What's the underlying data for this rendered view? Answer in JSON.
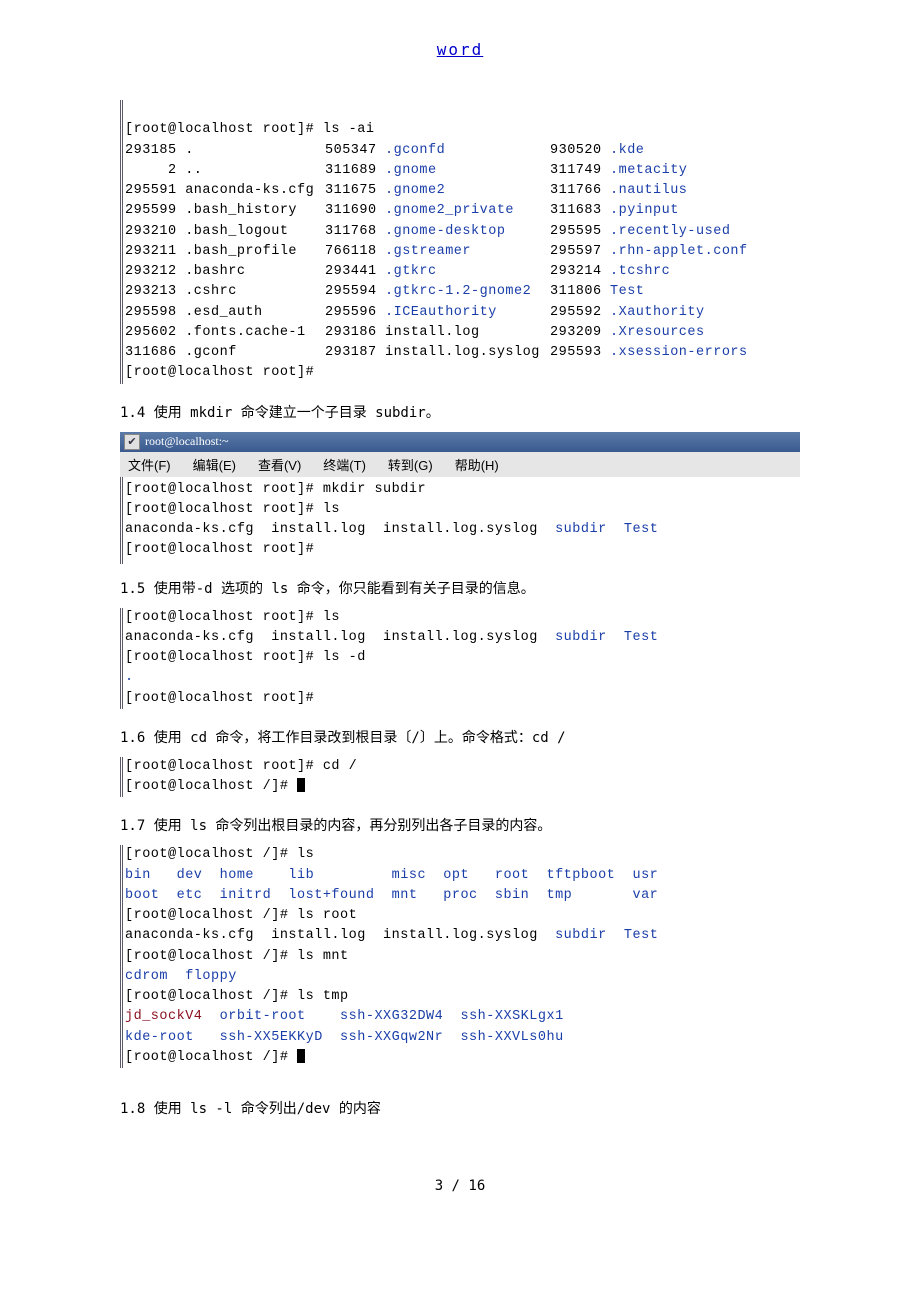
{
  "header": {
    "word_link": "word"
  },
  "ls_ai": {
    "prompt1": "[root@localhost root]# ls -ai",
    "col1": [
      "293185 .",
      "     2 ..",
      "295591 anaconda-ks.cfg",
      "295599 .bash_history",
      "293210 .bash_logout",
      "293211 .bash_profile",
      "293212 .bashrc",
      "293213 .cshrc",
      "295598 .esd_auth",
      "295602 .fonts.cache-1",
      "311686 .gconf"
    ],
    "col2_inode": [
      "505347",
      "311689",
      "311675",
      "311690",
      "311768",
      "766118",
      "293441",
      "295594",
      "295596",
      "293186",
      "293187"
    ],
    "col2_name": [
      ".gconfd",
      ".gnome",
      ".gnome2",
      ".gnome2_private",
      ".gnome-desktop",
      ".gstreamer",
      ".gtkrc",
      ".gtkrc-1.2-gnome2",
      ".ICEauthority",
      "install.log",
      "install.log.syslog"
    ],
    "col3_inode": [
      "930520",
      "311749",
      "311766",
      "311683",
      "295595",
      "295597",
      "293214",
      "311806",
      "295592",
      "293209",
      "295593"
    ],
    "col3_name": [
      ".kde",
      ".metacity",
      ".nautilus",
      ".pyinput",
      ".recently-used",
      ".rhn-applet.conf",
      ".tcshrc",
      "Test",
      ".Xauthority",
      ".Xresources",
      ".xsession-errors"
    ],
    "prompt2": "[root@localhost root]#"
  },
  "sec14": {
    "title": "1.4 使用 mkdir 命令建立一个子目录 subdir。",
    "window_title": "root@localhost:~",
    "menu": {
      "file": "文件(F)",
      "edit": "编辑(E)",
      "view": "查看(V)",
      "term": "终端(T)",
      "go": "转到(G)",
      "help": "帮助(H)"
    },
    "lines": [
      {
        "t": "[root@localhost root]# mkdir subdir"
      },
      {
        "t": "[root@localhost root]# ls"
      },
      {
        "parts": [
          {
            "t": "anaconda-ks.cfg  install.log  install.log.syslog  "
          },
          {
            "t": "subdir  Test",
            "cls": "blue"
          }
        ]
      },
      {
        "t": "[root@localhost root]#"
      }
    ]
  },
  "sec15": {
    "title": "1.5 使用带-d 选项的 ls 命令，你只能看到有关子目录的信息。",
    "lines": [
      {
        "t": "[root@localhost root]# ls"
      },
      {
        "parts": [
          {
            "t": "anaconda-ks.cfg  install.log  install.log.syslog  "
          },
          {
            "t": "subdir  Test",
            "cls": "blue"
          }
        ]
      },
      {
        "t": "[root@localhost root]# ls -d"
      },
      {
        "t": ".",
        "cls": "blue"
      },
      {
        "t": "[root@localhost root]#"
      }
    ]
  },
  "sec16": {
    "title": "1.6 使用 cd 命令，将工作目录改到根目录〔/〕上。命令格式：cd  /",
    "lines": [
      {
        "t": "[root@localhost root]# cd /"
      },
      {
        "t": "[root@localhost /]# ",
        "cursor": true
      }
    ]
  },
  "sec17": {
    "title": "1.7 使用 ls 命令列出根目录的内容，再分别列出各子目录的内容。",
    "lines": [
      {
        "t": "[root@localhost /]# ls"
      },
      {
        "parts": [
          {
            "t": "bin   dev  home    lib         misc  opt   root  tftpboot  usr",
            "cls": "blue"
          }
        ]
      },
      {
        "parts": [
          {
            "t": "boot  etc  initrd  lost+found  mnt   proc  sbin  tmp       var",
            "cls": "blue"
          }
        ]
      },
      {
        "t": "[root@localhost /]# ls root"
      },
      {
        "parts": [
          {
            "t": "anaconda-ks.cfg  install.log  install.log.syslog  "
          },
          {
            "t": "subdir  Test",
            "cls": "blue"
          }
        ]
      },
      {
        "t": "[root@localhost /]# ls mnt"
      },
      {
        "t": "cdrom  floppy",
        "cls": "blue"
      },
      {
        "t": "[root@localhost /]# ls tmp"
      },
      {
        "parts": [
          {
            "t": "jd_sockV4",
            "cls": "darkred"
          },
          {
            "t": "  "
          },
          {
            "t": "orbit-root    ssh-XXG32DW4  ssh-XXSKLgx1",
            "cls": "blue"
          }
        ]
      },
      {
        "parts": [
          {
            "t": "kde-root   ssh-XX5EKKyD  ssh-XXGqw2Nr  ssh-XXVLs0hu",
            "cls": "blue"
          }
        ]
      },
      {
        "t": "[root@localhost /]# ",
        "cursor": true
      }
    ]
  },
  "sec18": {
    "title": "1.8 使用 ls -l 命令列出/dev 的内容"
  },
  "footer": {
    "page": "3 / 16"
  }
}
